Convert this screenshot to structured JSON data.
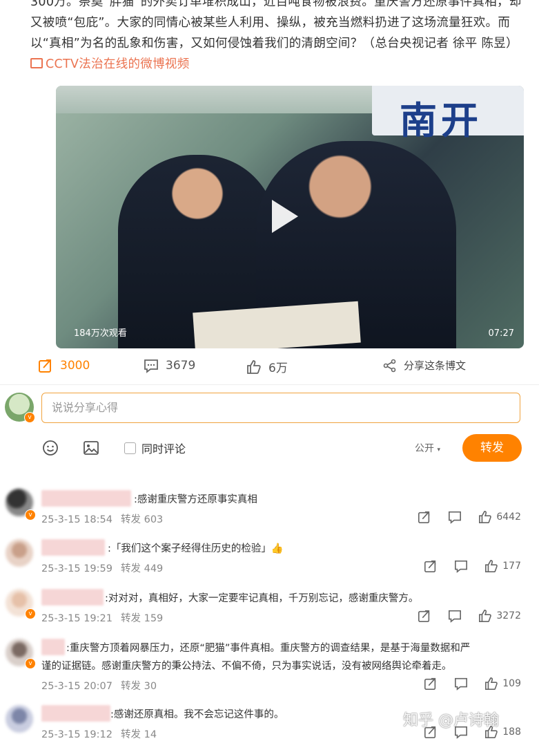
{
  "post": {
    "text": "300万。祭奠“胖猫”的外卖订单堆积成山，近百吨食物被浪费。重庆警方还原事件真相，却又被喷“包庇”。大家的同情心被某些人利用、操纵，被充当燃料扔进了这场流量狂欢。而以“真相”为名的乱象和伤害，又如何侵蚀着我们的清朗空间？（总台央视记者 徐平 陈昱）",
    "video_link": "CCTV法治在线的微博视频",
    "video": {
      "views": "184万次观看",
      "duration": "07:27",
      "sign_text": "南开"
    }
  },
  "actions": {
    "repost_count": "3000",
    "comment_count": "3679",
    "like_count": "6万",
    "share_label": "分享这条博文"
  },
  "composer": {
    "placeholder": "说说分享心得",
    "same_time_comment": "同时评论",
    "visibility": "公开",
    "repost_button": "转发"
  },
  "comments": [
    {
      "text": ":感谢重庆警方还原事实真相",
      "date": "25-3-15 18:54",
      "reposts": "转发 603",
      "likes": "6442"
    },
    {
      "text": ":「我们这个案子经得住历史的检验」👍",
      "date": "25-3-15 19:59",
      "reposts": "转发 449",
      "likes": "177"
    },
    {
      "text": ":对对对，真相好，大家一定要牢记真相，千万别忘记，感谢重庆警方。",
      "date": "25-3-15 19:21",
      "reposts": "转发 159",
      "likes": "3272"
    },
    {
      "text_line1": ":重庆警方顶着网暴压力，还原“肥猫”事件真相。重庆警方的调查结果，是基于海量数据和严",
      "text_line2": "谨的证据链。感谢重庆警方的秉公持法、不偏不倚，只为事实说话，没有被网络舆论牵着走。",
      "date": "25-3-15 20:07",
      "reposts": "转发 30",
      "likes": "109"
    },
    {
      "text": ":感谢还原真相。我不会忘记这件事的。",
      "date": "25-3-15 19:12",
      "reposts": "转发 14",
      "likes": "188"
    }
  ],
  "watermark": "知乎 @卢诗翰",
  "colors": {
    "accent": "#ff8200",
    "link": "#eb7350"
  }
}
